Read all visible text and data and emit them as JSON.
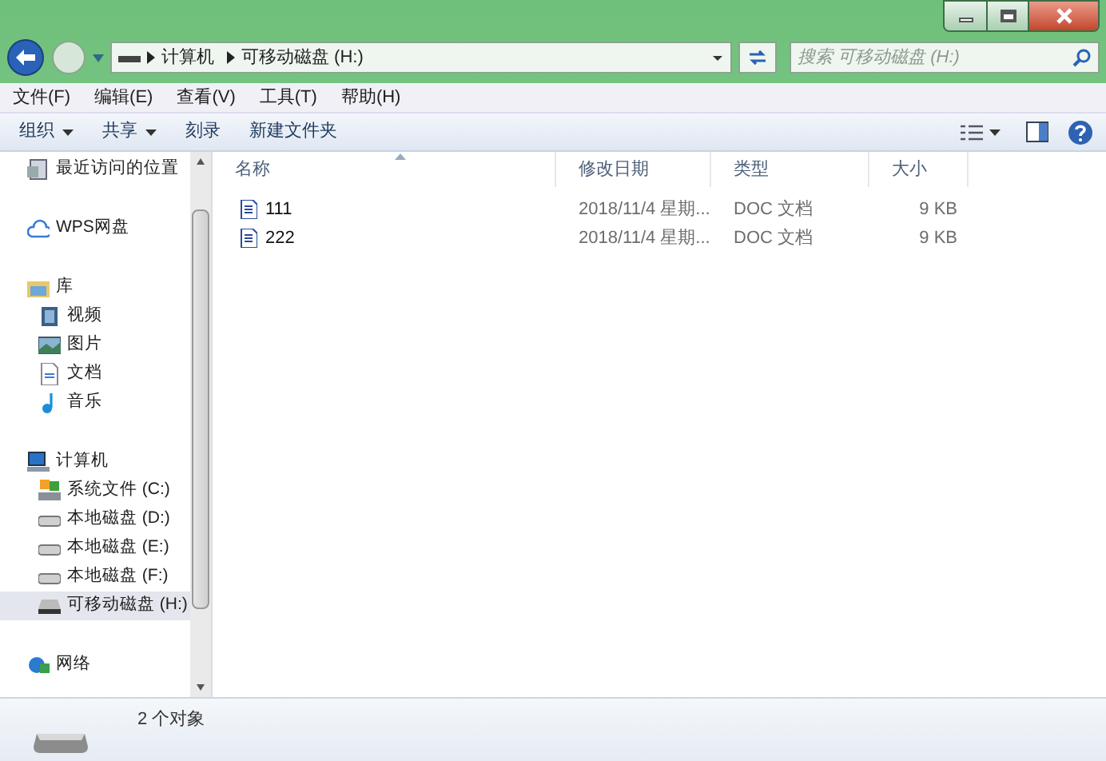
{
  "address_bar": {
    "path": [
      "计算机",
      "可移动磁盘 (H:)"
    ]
  },
  "search": {
    "placeholder": "搜索 可移动磁盘 (H:)"
  },
  "menu_bar": [
    "文件(F)",
    "编辑(E)",
    "查看(V)",
    "工具(T)",
    "帮助(H)"
  ],
  "toolbar": [
    {
      "label": "组织",
      "dropdown": true
    },
    {
      "label": "共享",
      "dropdown": true
    },
    {
      "label": "刻录",
      "dropdown": false
    },
    {
      "label": "新建文件夹",
      "dropdown": false
    }
  ],
  "sidebar": {
    "groups": [
      {
        "items": [
          {
            "label": "最近访问的位置",
            "selected": false
          }
        ]
      },
      {
        "items": [
          {
            "label": "WPS网盘",
            "selected": false
          }
        ]
      },
      {
        "items": [
          {
            "label": "库",
            "selected": false,
            "children": [
              {
                "label": "视频",
                "selected": false
              },
              {
                "label": "图片",
                "selected": false
              },
              {
                "label": "文档",
                "selected": false
              },
              {
                "label": "音乐",
                "selected": false
              }
            ]
          }
        ]
      },
      {
        "items": [
          {
            "label": "计算机",
            "selected": false,
            "children": [
              {
                "label": "系统文件 (C:)",
                "selected": false
              },
              {
                "label": "本地磁盘 (D:)",
                "selected": false
              },
              {
                "label": "本地磁盘 (E:)",
                "selected": false
              },
              {
                "label": "本地磁盘 (F:)",
                "selected": false
              },
              {
                "label": "可移动磁盘 (H:)",
                "selected": true
              }
            ]
          }
        ]
      },
      {
        "items": [
          {
            "label": "网络",
            "selected": false
          }
        ]
      }
    ]
  },
  "table": {
    "columns": [
      "名称",
      "修改日期",
      "类型",
      "大小"
    ],
    "rows": [
      {
        "name": "111",
        "modified": "2018/11/4 星期...",
        "type": "DOC 文档",
        "size": "9 KB"
      },
      {
        "name": "222",
        "modified": "2018/11/4 星期...",
        "type": "DOC 文档",
        "size": "9 KB"
      }
    ]
  },
  "status_bar": {
    "text": "2 个对象"
  }
}
